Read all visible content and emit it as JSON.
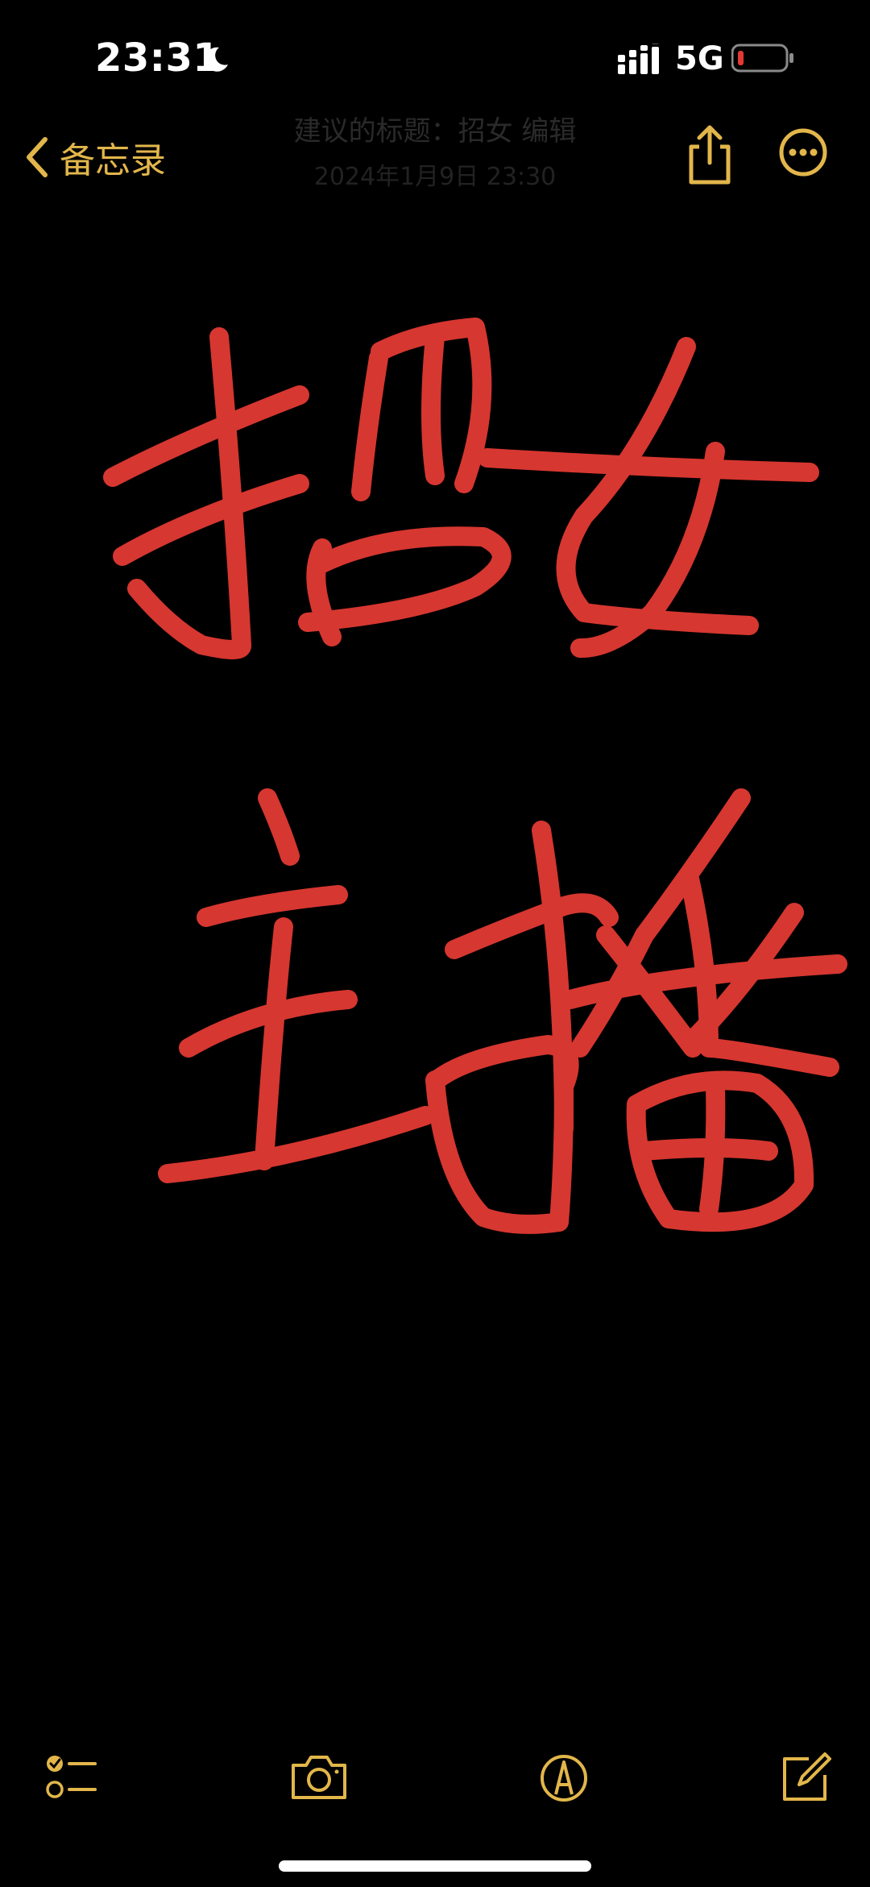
{
  "status_bar": {
    "time": "23:31",
    "network": "5G",
    "icons": [
      "moon-icon",
      "signal-bars-icon",
      "battery-low-icon"
    ]
  },
  "nav": {
    "back_label": "备忘录",
    "title": "建议的标题：招女 编辑",
    "subtitle": "2024年1月9日 23:30"
  },
  "note": {
    "handwritten_text": "招女主播",
    "ink_color": "#E23A33"
  },
  "toolbar": {
    "icons": [
      "checklist-icon",
      "camera-icon",
      "markup-pen-icon",
      "compose-icon"
    ]
  },
  "colors": {
    "accent": "#E2B64A",
    "background": "#000000",
    "ink": "#E23A33"
  }
}
